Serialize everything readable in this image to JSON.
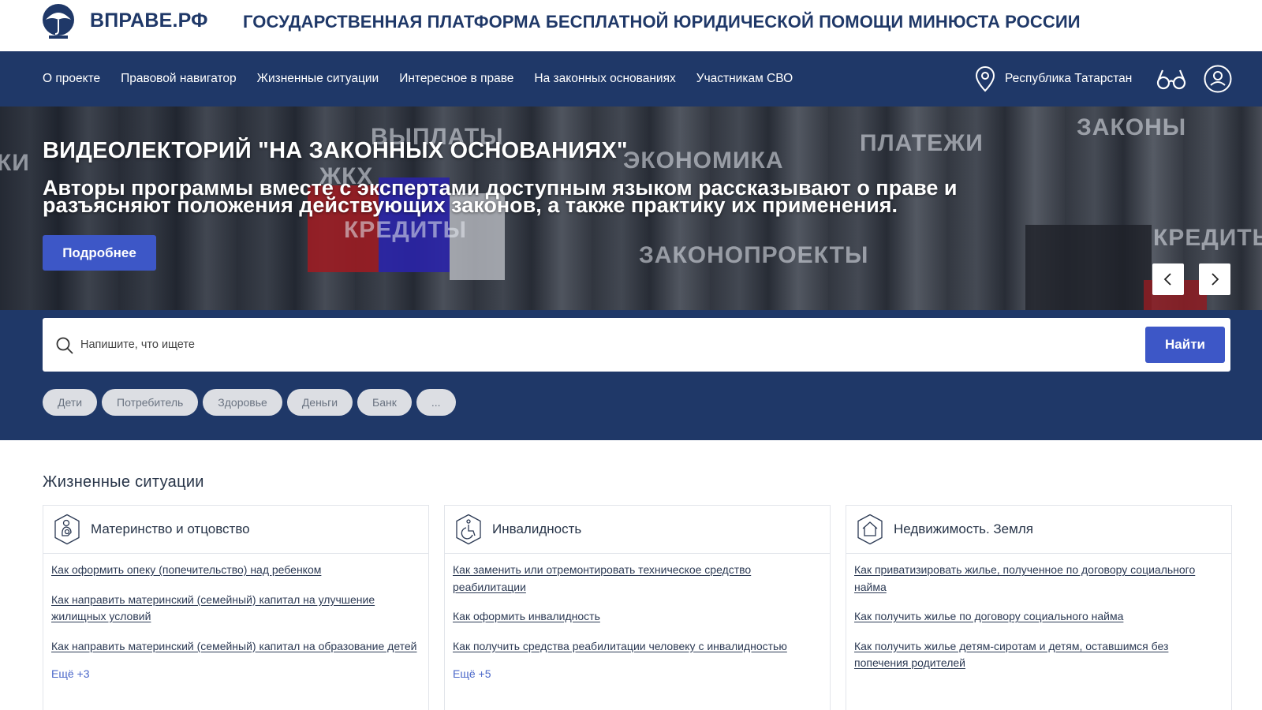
{
  "header": {
    "brand": "ВПРАВЕ.РФ",
    "platform_title": "ГОСУДАРСТВЕННАЯ ПЛАТФОРМА БЕСПЛАТНОЙ ЮРИДИЧЕСКОЙ ПОМОЩИ МИНЮСТА РОССИИ"
  },
  "nav": {
    "items": [
      "О проекте",
      "Правовой навигатор",
      "Жизненные ситуации",
      "Интересное в праве",
      "На законных основаниях",
      "Участникам СВО"
    ],
    "region": "Республика Татарстан",
    "icons": [
      "location-pin-icon",
      "low-vision-glasses-icon",
      "user-account-icon"
    ]
  },
  "banner": {
    "title": "ВИДЕОЛЕКТОРИЙ \"НА ЗАКОННЫХ ОСНОВАНИЯХ\"",
    "subtitle": "Авторы программы вместе с экспертами доступным языком рассказывают о праве и разъясняют положения действующих законов, а также практику их применения.",
    "button": "Подробнее",
    "bg_words": [
      "ВЫПЛАТЫ",
      "ЖКХ",
      "ЭКОНОМИКА",
      "КРЕДИТЫ",
      "ПЛАТЕЖИ",
      "ЗАКОНЫ",
      "ЗАКОНОПРОЕКТЫ",
      "КРЕДИТЫ",
      "КИ"
    ]
  },
  "search": {
    "placeholder": "Напишите, что ищете",
    "button": "Найти",
    "tags": [
      "Дети",
      "Потребитель",
      "Здоровье",
      "Деньги",
      "Банк",
      "..."
    ]
  },
  "life_situations": {
    "title": "Жизненные ситуации",
    "cards": [
      {
        "title": "Материнство и отцовство",
        "links": [
          "Как оформить опеку (попечительство) над ребенком",
          "Как направить материнский (семейный) капитал на улучшение жилищных условий",
          "Как направить материнский (семейный) капитал на образование детей"
        ],
        "more": "Ещё +3"
      },
      {
        "title": "Инвалидность",
        "links": [
          "Как заменить или отремонтировать техническое средство реабилитации",
          "Как оформить инвалидность",
          "Как получить средства реабилитации человеку с инвалидностью"
        ],
        "more": "Ещё +5"
      },
      {
        "title": "Недвижимость. Земля",
        "links": [
          "Как приватизировать жилье, полученное по договору социального найма",
          "Как получить жилье по договору социального найма",
          "Как получить жилье детям-сиротам и детям, оставшимся без попечения родителей"
        ],
        "more": ""
      }
    ]
  },
  "colors": {
    "navy": "#1f3868",
    "accent_blue": "#3d57c7",
    "link_more": "#4a67c9",
    "tag_bg": "#dcdee3"
  }
}
